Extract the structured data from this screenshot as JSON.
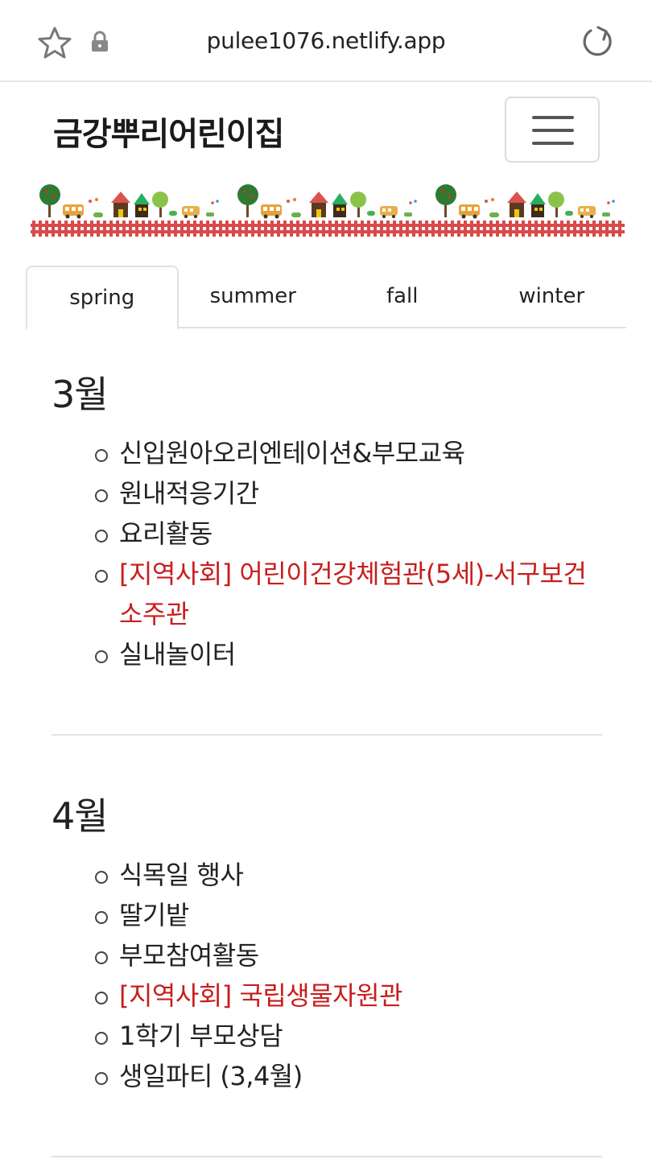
{
  "browser": {
    "url": "pulee1076.netlify.app"
  },
  "navbar": {
    "brand": "금강뿌리어린이집"
  },
  "tabs": [
    {
      "label": "spring",
      "active": true
    },
    {
      "label": "summer",
      "active": false
    },
    {
      "label": "fall",
      "active": false
    },
    {
      "label": "winter",
      "active": false
    }
  ],
  "colors": {
    "highlight_text": "#c81e1e",
    "fence": "#d94a4a"
  },
  "months": [
    {
      "title": "3월",
      "events": [
        {
          "text": "신입원아오리엔테이션&부모교육",
          "highlight": false
        },
        {
          "text": "원내적응기간",
          "highlight": false
        },
        {
          "text": "요리활동",
          "highlight": false
        },
        {
          "text": "[지역사회] 어린이건강체험관(5세)-서구보건소주관",
          "highlight": true
        },
        {
          "text": "실내놀이터",
          "highlight": false
        }
      ]
    },
    {
      "title": "4월",
      "events": [
        {
          "text": "식목일 행사",
          "highlight": false
        },
        {
          "text": "딸기밭",
          "highlight": false
        },
        {
          "text": "부모참여활동",
          "highlight": false
        },
        {
          "text": "[지역사회] 국립생물자원관",
          "highlight": true
        },
        {
          "text": "1학기 부모상담",
          "highlight": false
        },
        {
          "text": "생일파티 (3,4월)",
          "highlight": false
        }
      ]
    }
  ]
}
